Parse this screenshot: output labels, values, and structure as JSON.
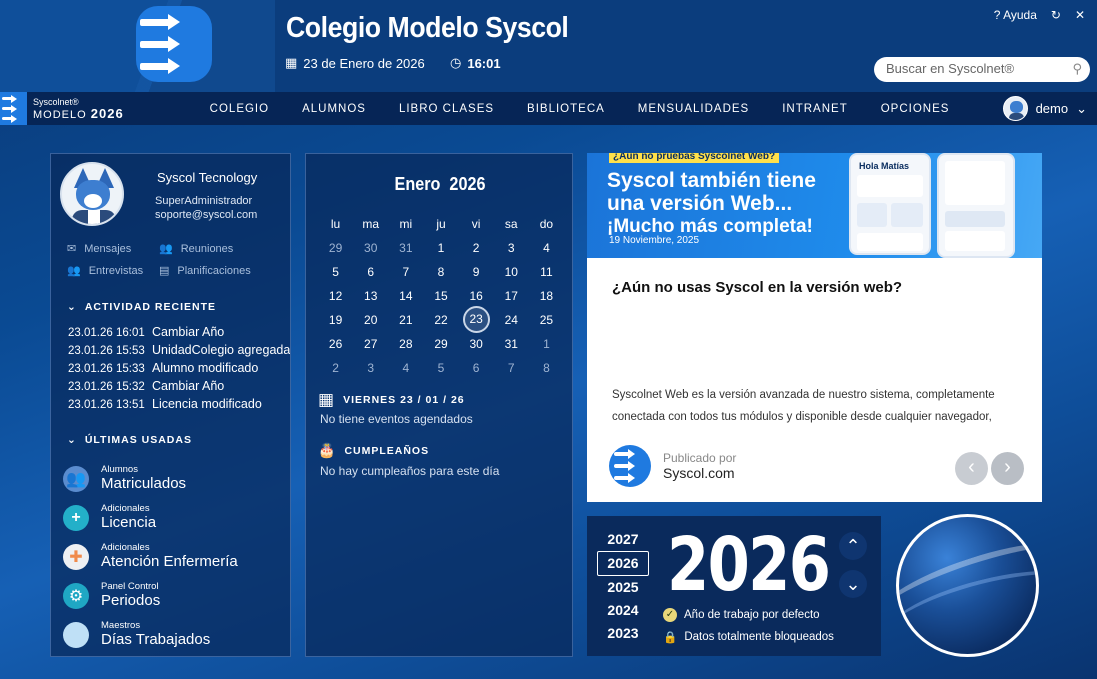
{
  "app": {
    "title": "Colegio Modelo Syscol",
    "date": "23 de Enero de 2026",
    "time": "16:01",
    "help": "Ayuda",
    "search_placeholder": "Buscar en Syscolnet®"
  },
  "brand": {
    "line1": "Syscolnet®",
    "line2": "MODELO",
    "year": "2026"
  },
  "menu": [
    "COLEGIO",
    "ALUMNOS",
    "LIBRO CLASES",
    "BIBLIOTECA",
    "MENSUALIDADES",
    "INTRANET",
    "OPCIONES"
  ],
  "user": {
    "name": "demo"
  },
  "profile": {
    "name": "Syscol Tecnology",
    "role": "SuperAdministrador",
    "email": "soporte@syscol.com"
  },
  "quick_links": [
    "Mensajes",
    "Reuniones",
    "Entrevistas",
    "Planificaciones"
  ],
  "recent": {
    "title": "ACTIVIDAD RECIENTE",
    "items": [
      {
        "date": "23.01.26 16:01",
        "text": "Cambiar Año"
      },
      {
        "date": "23.01.26 15:53",
        "text": "UnidadColegio agregada"
      },
      {
        "date": "23.01.26 15:33",
        "text": "Alumno modificado"
      },
      {
        "date": "23.01.26 15:32",
        "text": "Cambiar Año"
      },
      {
        "date": "23.01.26 13:51",
        "text": "Licencia modificado"
      }
    ]
  },
  "last_used": {
    "title": "ÚLTIMAS USADAS",
    "items": [
      {
        "cat": "Alumnos",
        "name": "Matriculados",
        "color": "#5a8ccf"
      },
      {
        "cat": "Adicionales",
        "name": "Licencia",
        "color": "#23b0c9"
      },
      {
        "cat": "Adicionales",
        "name": "Atención Enfermería",
        "color": "#eef0f3"
      },
      {
        "cat": "Panel Control",
        "name": "Periodos",
        "color": "#1fa7c4"
      },
      {
        "cat": "Maestros",
        "name": "Días Trabajados",
        "color": "#bfe0f6"
      }
    ]
  },
  "calendar": {
    "month": "Enero",
    "year": "2026",
    "weekdays": [
      "lu",
      "ma",
      "mi",
      "ju",
      "vi",
      "sa",
      "do"
    ],
    "days": [
      "29",
      "30",
      "31",
      "1",
      "2",
      "3",
      "4",
      "5",
      "6",
      "7",
      "8",
      "9",
      "10",
      "11",
      "12",
      "13",
      "14",
      "15",
      "16",
      "17",
      "18",
      "19",
      "20",
      "21",
      "22",
      "23",
      "24",
      "25",
      "26",
      "27",
      "28",
      "29",
      "30",
      "31",
      "1",
      "2",
      "3",
      "4",
      "5",
      "6",
      "7",
      "8"
    ],
    "today": "23"
  },
  "events": {
    "day_title": "VIERNES 23 / 01 / 26",
    "day_text": "No tiene eventos agendados",
    "bday_title": "CUMPLEAÑOS",
    "bday_text": "No hay cumpleaños para este día"
  },
  "news": {
    "tag": "¿Aún no pruebas Syscolnet Web?",
    "banner_line1": "Syscol también tiene",
    "banner_line2": "una versión Web...",
    "banner_line3": "¡Mucho más completa!",
    "banner_date": "19 Noviembre, 2025",
    "phone_greeting": "Hola Matías",
    "title": "¿Aún no usas Syscol en la versión web?",
    "body": "Syscolnet Web es la versión avanzada de nuestro sistema, completamente conectada con todos tus módulos y disponible desde cualquier navegador,",
    "pub_label": "Publicado por",
    "pub_value": "Syscol.com"
  },
  "years": {
    "list": [
      "2027",
      "2026",
      "2025",
      "2024",
      "2023"
    ],
    "selected": "2026",
    "note1": "Año de trabajo por defecto",
    "note2": "Datos totalmente bloqueados"
  }
}
